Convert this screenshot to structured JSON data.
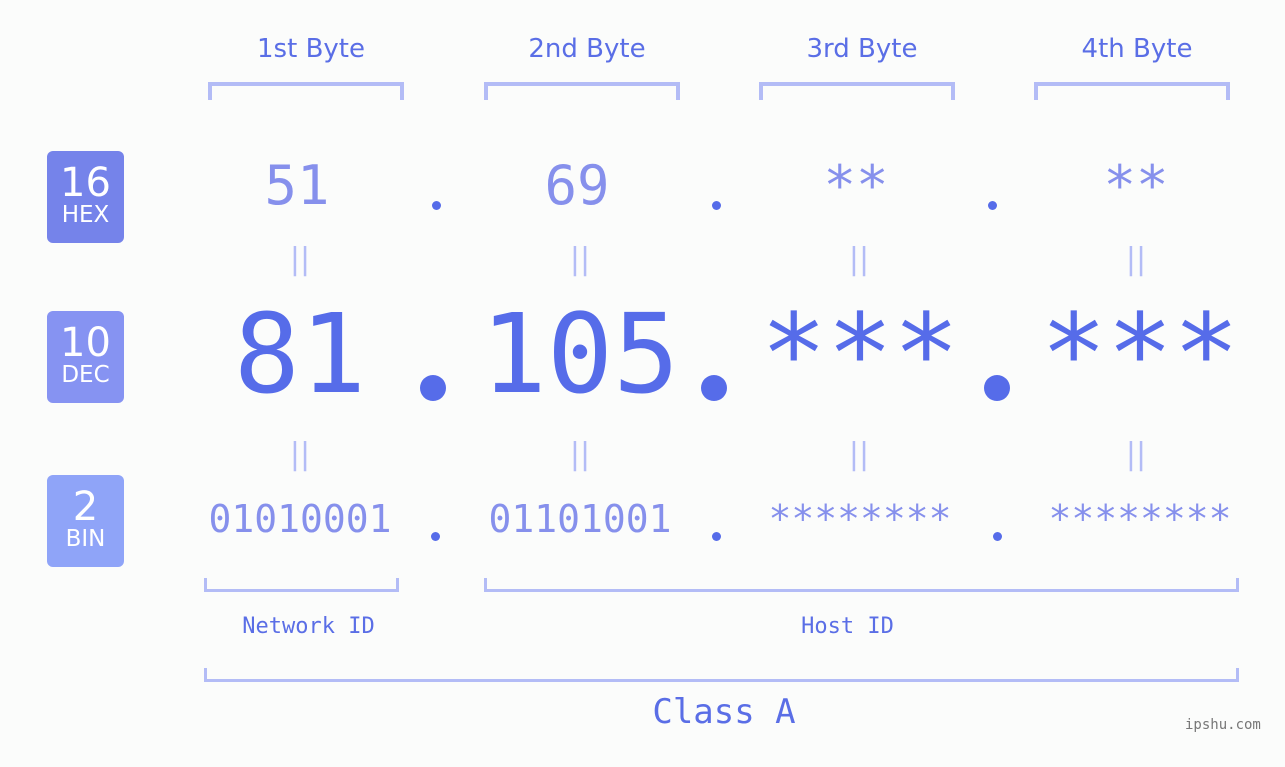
{
  "bytes": [
    {
      "header": "1st Byte",
      "hex": "51",
      "dec": "81",
      "bin": "01010001"
    },
    {
      "header": "2nd Byte",
      "hex": "69",
      "dec": "105",
      "bin": "01101001"
    },
    {
      "header": "3rd Byte",
      "hex": "**",
      "dec": "***",
      "bin": "********"
    },
    {
      "header": "4th Byte",
      "hex": "**",
      "dec": "***",
      "bin": "********"
    }
  ],
  "badges": {
    "hex": {
      "num": "16",
      "label": "HEX",
      "color": "#7583ea"
    },
    "dec": {
      "num": "10",
      "label": "DEC",
      "color": "#8693f2"
    },
    "bin": {
      "num": "2",
      "label": "BIN",
      "color": "#8fa4f8"
    }
  },
  "equals_glyph": "||",
  "labels": {
    "network_id": "Network ID",
    "host_id": "Host ID",
    "class": "Class A"
  },
  "watermark": "ipshu.com",
  "colors": {
    "accent": "#566ce9",
    "light_accent": "#8690ec",
    "bracket": "#b3bcf6",
    "background": "#fbfcfb"
  }
}
